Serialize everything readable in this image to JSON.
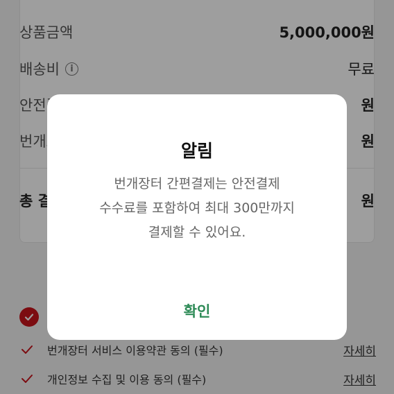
{
  "summary": {
    "product_amount_label": "상품금액",
    "product_amount_value": "5,000,000원",
    "shipping_label": "배송비",
    "shipping_value": "무료",
    "row3_label": "안전결제 수수료",
    "row3_value": "원",
    "row4_label": "번개포인트",
    "row4_value": "원",
    "total_label": "총 결제금액",
    "total_value": "원"
  },
  "agreements": {
    "all_label": "",
    "items": [
      {
        "label": "번개장터 서비스 이용약관 동의 (필수)",
        "detail": "자세히"
      },
      {
        "label": "개인정보 수집 및 이용 동의 (필수)",
        "detail": "자세히"
      }
    ]
  },
  "dialog": {
    "title": "알림",
    "message_line1": "번개장터 간편결제는 안전결제",
    "message_line2": "수수료를 포함하여 최대 300만까지",
    "message_line3": "결제할 수 있어요.",
    "confirm_label": "확인"
  },
  "colors": {
    "accent_red": "#c8141c",
    "confirm_green": "#2e8b57"
  },
  "icons": {
    "info": "info-icon",
    "check_all": "check-circle-icon",
    "tick": "check-icon"
  }
}
